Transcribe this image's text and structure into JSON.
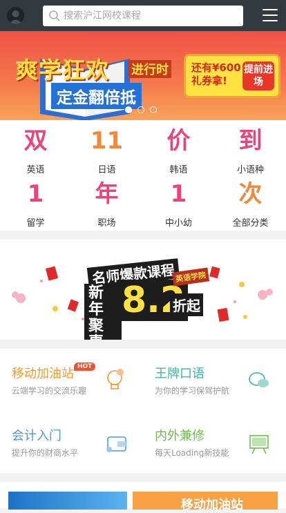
{
  "header": {
    "search_placeholder": "搜索沪江网校课程",
    "avatar_icon": "user-avatar-icon",
    "menu_icon": "hamburger-menu-icon"
  },
  "banner": {
    "headline": "爽学狂欢",
    "tag": "进行时",
    "subline": "定金翻倍抵",
    "cta_text": "还有¥600礼券拿!",
    "cta_button": "提前进场",
    "slides": 3,
    "active_slide": 1
  },
  "categories": [
    {
      "glyph": "双",
      "label": "英语"
    },
    {
      "glyph": "11",
      "label": "日语"
    },
    {
      "glyph": "价",
      "label": "韩语"
    },
    {
      "glyph": "到",
      "label": "小语种"
    },
    {
      "glyph": "1",
      "label": "留学"
    },
    {
      "glyph": "年",
      "label": "职场"
    },
    {
      "glyph": "1",
      "label": "中小幼"
    },
    {
      "glyph": "次",
      "label": "全部分类"
    }
  ],
  "promo": {
    "line1": "名师爆款课程",
    "line2": "新年聚惠",
    "discount": "8.2",
    "suffix": "折起",
    "badge": "英语学院"
  },
  "services": [
    {
      "title": "移动加油站",
      "desc": "云端学习的交流乐趣",
      "badge": "HOT",
      "color": "#f39a2f",
      "icon": "lightbulb-icon"
    },
    {
      "title": "王牌口语",
      "desc": "为你的学习保驾护航",
      "color": "#3ab6a1",
      "icon": "chat-bubbles-icon"
    },
    {
      "title": "会计入门",
      "desc": "提升你的财商水平",
      "color": "#4a9ad6",
      "icon": "wallet-icon"
    },
    {
      "title": "内外兼修",
      "desc": "每天Loading新技能",
      "color": "#6bbf4a",
      "icon": "presentation-board-icon"
    }
  ],
  "bottom": {
    "card2_text": "移动加油站"
  }
}
